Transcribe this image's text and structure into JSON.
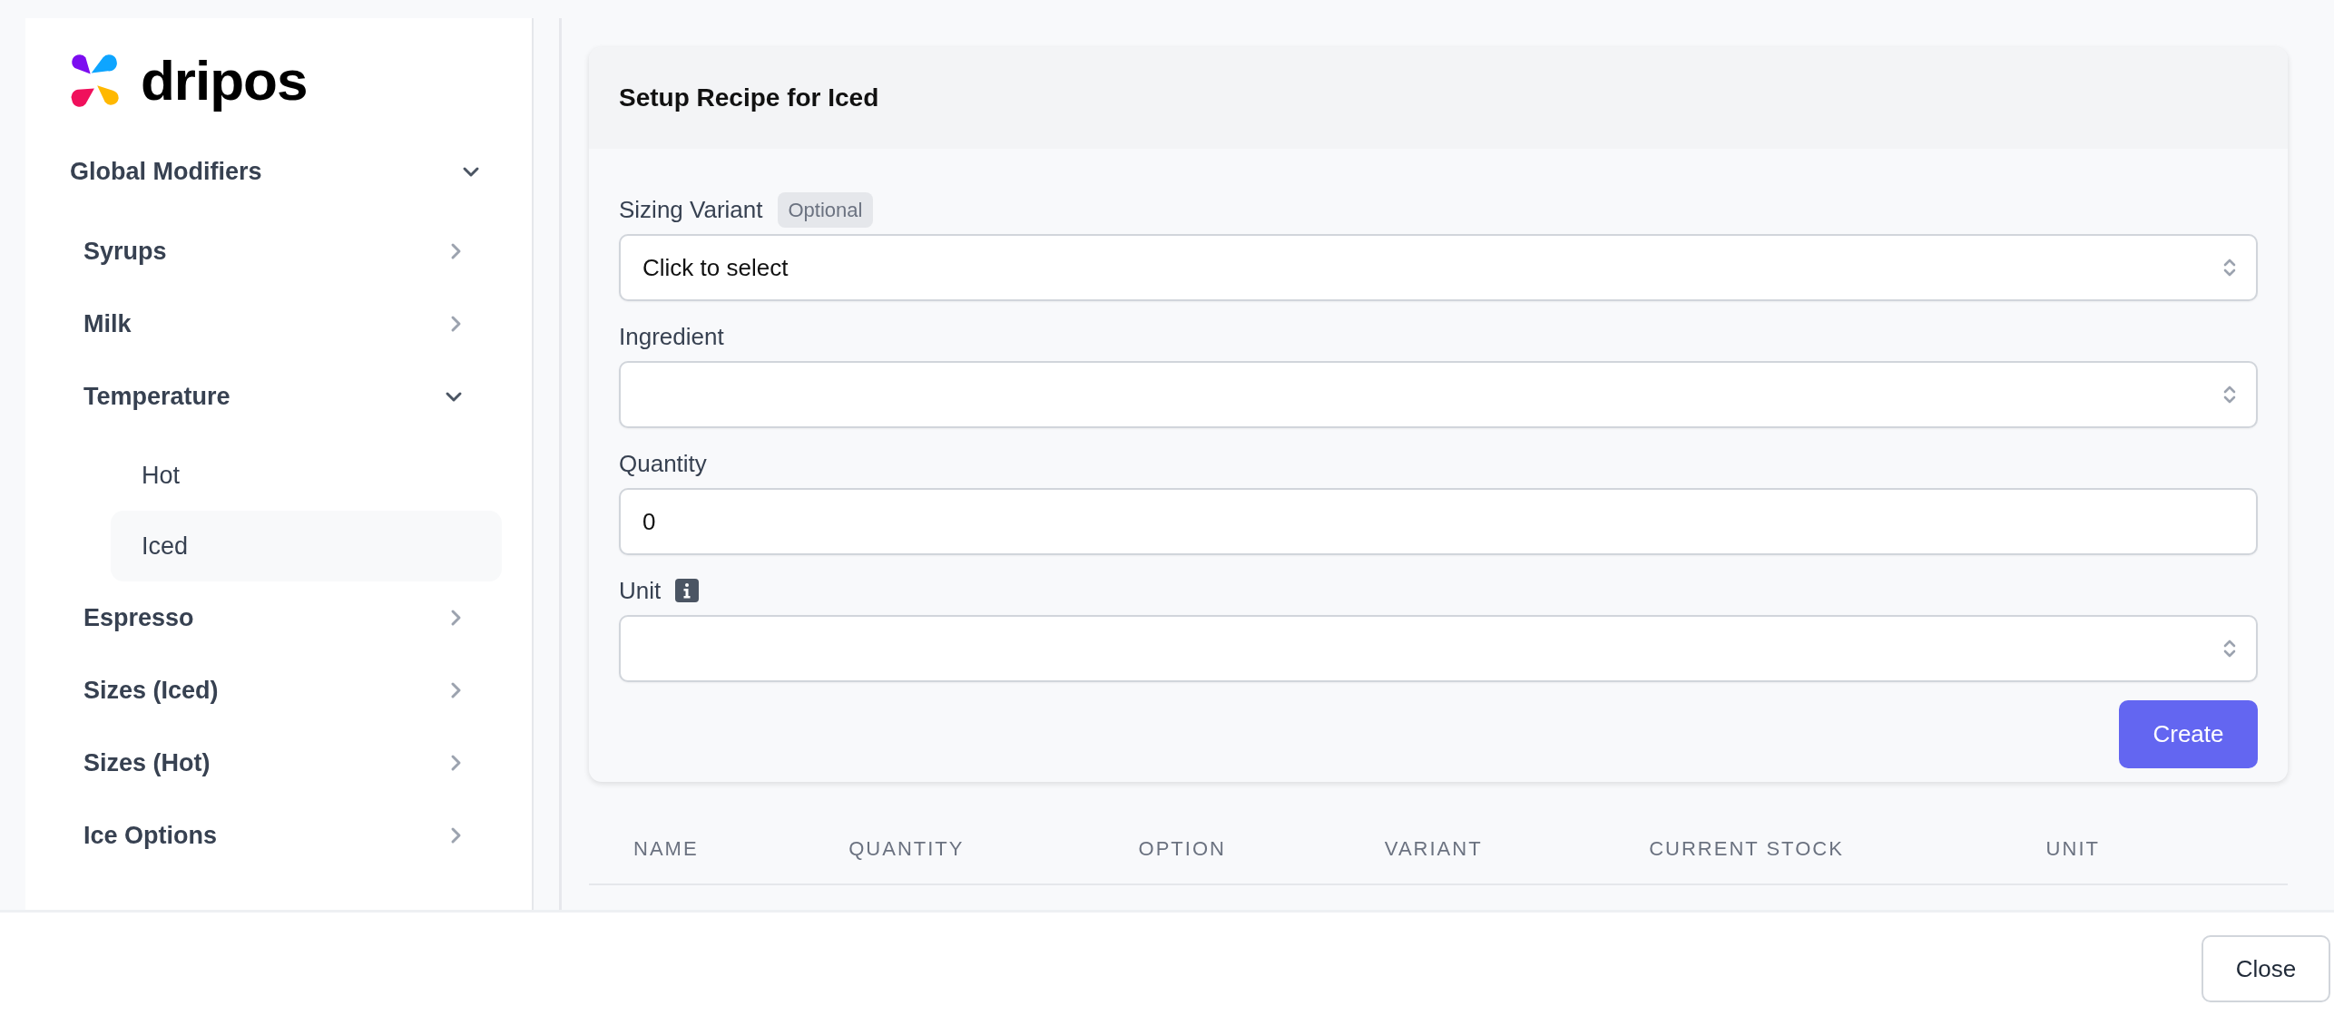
{
  "logo": {
    "text": "dripos"
  },
  "sidebar": {
    "items": [
      {
        "label": "Global Modifiers",
        "expanded": true,
        "children": [
          {
            "label": "Syrups",
            "expanded": false
          },
          {
            "label": "Milk",
            "expanded": false
          },
          {
            "label": "Temperature",
            "expanded": true,
            "children": [
              {
                "label": "Hot",
                "selected": false
              },
              {
                "label": "Iced",
                "selected": true
              }
            ]
          },
          {
            "label": "Espresso",
            "expanded": false
          },
          {
            "label": "Sizes (Iced)",
            "expanded": false
          },
          {
            "label": "Sizes (Hot)",
            "expanded": false
          },
          {
            "label": "Ice Options",
            "expanded": false
          }
        ]
      }
    ]
  },
  "form": {
    "title": "Setup Recipe for Iced",
    "fields": [
      {
        "kind": "select",
        "label": "Sizing Variant",
        "badge": "Optional",
        "placeholder": "Click to select"
      },
      {
        "kind": "select",
        "label": "Ingredient"
      },
      {
        "kind": "input",
        "label": "Quantity",
        "value": "0"
      },
      {
        "kind": "select",
        "label": "Unit",
        "info": true
      }
    ],
    "submit": "Create"
  },
  "table": {
    "columns": [
      "NAME",
      "QUANTITY",
      "OPTION",
      "VARIANT",
      "CURRENT STOCK",
      "UNIT"
    ]
  },
  "footer": {
    "buttons": [
      "Close"
    ]
  }
}
